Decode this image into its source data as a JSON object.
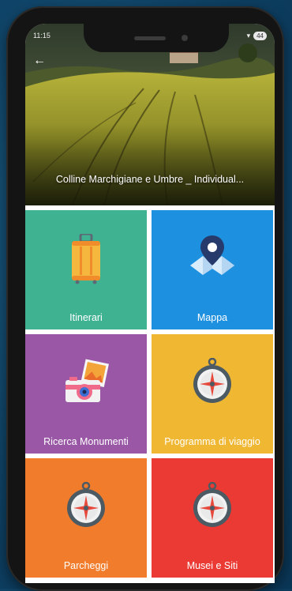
{
  "status_bar": {
    "time": "11:15",
    "battery": "44"
  },
  "header": {
    "title": "Colline Marchigiane e Umbre _ Individual..."
  },
  "menu": [
    {
      "label": "Itinerari",
      "color": "#3fb291",
      "icon": "suitcase-icon"
    },
    {
      "label": "Mappa",
      "color": "#1e90e0",
      "icon": "map-pin-icon"
    },
    {
      "label": "Ricerca Monumenti",
      "color": "#9a57a6",
      "icon": "camera-photo-icon"
    },
    {
      "label": "Programma di viaggio",
      "color": "#f0b733",
      "icon": "compass-icon"
    },
    {
      "label": "Parcheggi",
      "color": "#f07c2c",
      "icon": "compass-icon"
    },
    {
      "label": "Musei e Siti",
      "color": "#ea3a33",
      "icon": "compass-icon"
    }
  ]
}
